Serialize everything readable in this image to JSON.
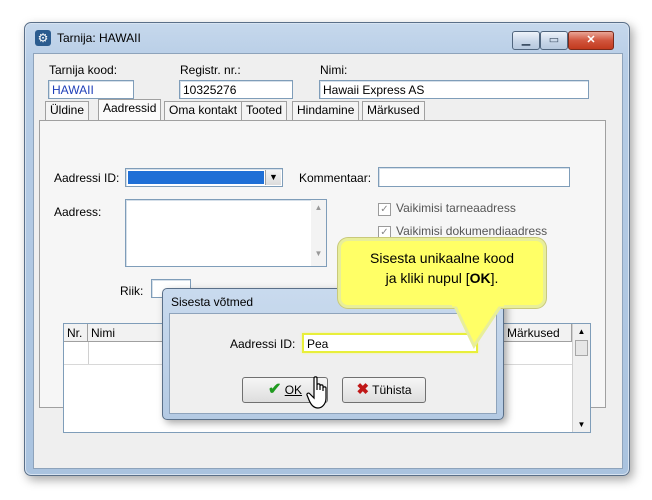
{
  "window": {
    "title": "Tarnija: HAWAII",
    "controls": {
      "minimize": "▁",
      "maximize": "▭",
      "close": "✕"
    }
  },
  "header": {
    "supplier_code_label": "Tarnija kood:",
    "supplier_code_value": "HAWAII",
    "reg_no_label": "Registr. nr.:",
    "reg_no_value": "10325276",
    "name_label": "Nimi:",
    "name_value": "Hawaii Express AS"
  },
  "tabs": [
    {
      "label": "Üldine"
    },
    {
      "label": "Aadressid",
      "active": true
    },
    {
      "label": "Oma kontakt"
    },
    {
      "label": "Tooted"
    },
    {
      "label": "Hindamine"
    },
    {
      "label": "Märkused"
    }
  ],
  "address_tab": {
    "address_id_label": "Aadressi ID:",
    "comment_label": "Kommentaar:",
    "address_label": "Aadress:",
    "default_delivery_label": "Vaikimisi tarneaadress",
    "default_document_label": "Vaikimisi dokumendiaadress",
    "country_label": "Riik:"
  },
  "grid": {
    "columns": [
      "Nr.",
      "Nimi",
      "Märkused"
    ]
  },
  "dialog": {
    "title": "Sisesta võtmed",
    "field_label": "Aadressi ID:",
    "field_value": "Pea",
    "ok_label": "OK",
    "cancel_label": "Tühista"
  },
  "callout": {
    "line1": "Sisesta unikaalne kood",
    "line2_prefix": "ja kliki nupul [",
    "line2_bold": "OK",
    "line2_suffix": "]."
  },
  "colors": {
    "accent_selection": "#1f6fd6",
    "callout_fill": "#ffff66",
    "ok_check": "#1f9a1f",
    "cancel_x": "#c01818"
  }
}
